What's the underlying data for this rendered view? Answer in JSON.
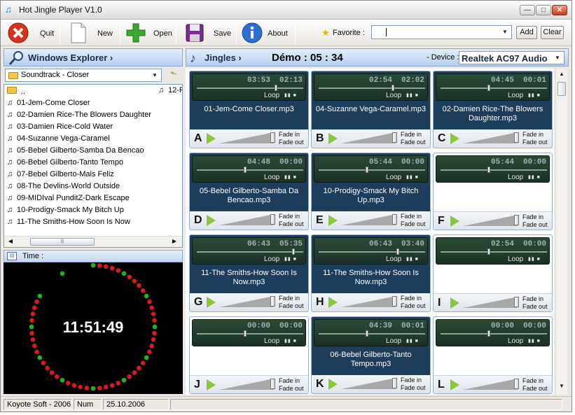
{
  "window": {
    "title": "Hot Jingle Player V1.0"
  },
  "toolbar": {
    "quit": "Quit",
    "new": "New",
    "open": "Open",
    "save": "Save",
    "about": "About",
    "favorite_label": "Favorite :",
    "favorite_value": "",
    "add": "Add",
    "clear": "Clear"
  },
  "explorer": {
    "title": "Windows Explorer ›",
    "folder": "Soundtrack - Closer",
    "files": [
      {
        "name": ".."
      },
      {
        "name": "01-Jem-Come Closer"
      },
      {
        "name": "02-Damien Rice-The Blowers Daughter"
      },
      {
        "name": "03-Damien Rice-Cold Water"
      },
      {
        "name": "04-Suzanne Vega-Caramel"
      },
      {
        "name": "05-Bebel Gilberto-Samba Da Bencao"
      },
      {
        "name": "06-Bebel Gilberto-Tanto Tempo"
      },
      {
        "name": "07-Bebel Gilberto-Mais Feliz"
      },
      {
        "name": "08-The Devlins-World Outside"
      },
      {
        "name": "09-MIDIval PunditZ-Dark Escape"
      },
      {
        "name": "10-Prodigy-Smack My Bitch Up"
      },
      {
        "name": "11-The Smiths-How Soon Is Now"
      }
    ],
    "second_column_item": "12-F"
  },
  "time": {
    "label": "Time :",
    "clock": "11:51:49"
  },
  "jingles": {
    "title": "Jingles ›",
    "demo": "Démo : 05 : 34",
    "device_label": "- Device :",
    "device": "Realtek AC97 Audio",
    "loop": "Loop",
    "fade_in": "Fade in",
    "fade_out": "Fade out",
    "cards": [
      {
        "letter": "A",
        "t1": "03:53",
        "t2": "02:13",
        "pos": 0.75,
        "name": "01-Jem-Come Closer.mp3"
      },
      {
        "letter": "B",
        "t1": "02:54",
        "t2": "02:02",
        "pos": 0.7,
        "name": "04-Suzanne Vega-Caramel.mp3"
      },
      {
        "letter": "C",
        "t1": "04:45",
        "t2": "00:01",
        "pos": 0.45,
        "name": "02-Damien Rice-The Blowers Daughter.mp3"
      },
      {
        "letter": "D",
        "t1": "04:48",
        "t2": "00:00",
        "pos": 0.45,
        "name": "05-Bebel Gilberto-Samba Da Bencao.mp3"
      },
      {
        "letter": "E",
        "t1": "05:44",
        "t2": "00:00",
        "pos": 0.45,
        "name": "10-Prodigy-Smack My Bitch Up.mp3"
      },
      {
        "letter": "F",
        "t1": "05:44",
        "t2": "00:00",
        "pos": 0.45,
        "name": ""
      },
      {
        "letter": "G",
        "t1": "06:43",
        "t2": "05:35",
        "pos": 0.92,
        "name": "11-The Smiths-How Soon Is Now.mp3"
      },
      {
        "letter": "H",
        "t1": "06:43",
        "t2": "03:40",
        "pos": 0.75,
        "name": "11-The Smiths-How Soon Is Now.mp3"
      },
      {
        "letter": "I",
        "t1": "02:54",
        "t2": "00:00",
        "pos": 0.45,
        "name": ""
      },
      {
        "letter": "J",
        "t1": "00:00",
        "t2": "00:00",
        "pos": 0.45,
        "name": ""
      },
      {
        "letter": "K",
        "t1": "04:39",
        "t2": "00:01",
        "pos": 0.45,
        "name": "06-Bebel Gilberto-Tanto Tempo.mp3"
      },
      {
        "letter": "L",
        "t1": "00:00",
        "t2": "00:00",
        "pos": 0.45,
        "name": ""
      }
    ]
  },
  "status": {
    "company": "Koyote Soft - 2006",
    "num": "Num",
    "date": "25.10.2006"
  },
  "colors": {
    "card_active": "#1d3d5c",
    "play_green": "#8cc63f",
    "header_blue": "#b8ceee"
  },
  "icons": {
    "quit": "red-x-icon",
    "new": "page-icon",
    "open": "plus-icon",
    "save": "floppy-icon",
    "about": "info-icon"
  }
}
